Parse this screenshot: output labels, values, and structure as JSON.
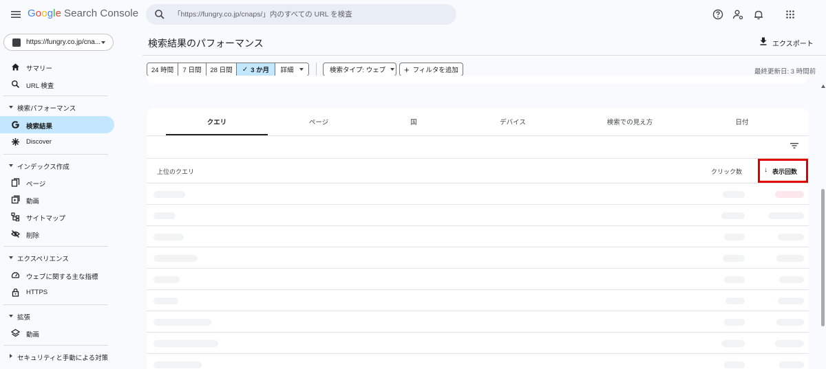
{
  "app": {
    "logo_letters": [
      "G",
      "o",
      "o",
      "g",
      "l",
      "e"
    ],
    "product": "Search Console"
  },
  "search": {
    "placeholder": "「https://fungry.co.jp/cnaps/」内のすべての URL を検査"
  },
  "property": {
    "label": "https://fungry.co.jp/cna..."
  },
  "sidebar": {
    "top_items": [
      {
        "label": "サマリー",
        "icon": "home-icon"
      },
      {
        "label": "URL 検査",
        "icon": "search-icon"
      }
    ],
    "sections": [
      {
        "title": "検索パフォーマンス",
        "items": [
          {
            "label": "検索結果",
            "icon": "google-g-icon",
            "active": true
          },
          {
            "label": "Discover",
            "icon": "asterisk-icon"
          }
        ]
      },
      {
        "title": "インデックス作成",
        "items": [
          {
            "label": "ページ",
            "icon": "pages-icon"
          },
          {
            "label": "動画",
            "icon": "video-page-icon"
          },
          {
            "label": "サイトマップ",
            "icon": "sitemap-icon"
          },
          {
            "label": "削除",
            "icon": "removal-icon"
          }
        ]
      },
      {
        "title": "エクスペリエンス",
        "items": [
          {
            "label": "ウェブに関する主な指標",
            "icon": "gauge-icon"
          },
          {
            "label": "HTTPS",
            "icon": "lock-icon"
          }
        ]
      },
      {
        "title": "拡張",
        "items": [
          {
            "label": "動画",
            "icon": "layers-icon"
          }
        ]
      },
      {
        "title": "セキュリティと手動による対策",
        "collapsed": true,
        "items": []
      }
    ]
  },
  "header": {
    "title": "検索結果のパフォーマンス",
    "export_label": "エクスポート"
  },
  "filters": {
    "date_ranges": [
      "24 時間",
      "7 日間",
      "28 日間",
      "3 か月"
    ],
    "selected_range": "3 か月",
    "details_label": "詳細",
    "search_type_label": "検索タイプ: ウェブ",
    "add_filter_label": "フィルタを追加",
    "last_updated": "最終更新日: 3 時間前"
  },
  "tabs": [
    "クエリ",
    "ページ",
    "国",
    "デバイス",
    "検索での見え方",
    "日付"
  ],
  "active_tab": "クエリ",
  "table": {
    "col_query": "上位のクエリ",
    "col_clicks": "クリック数",
    "col_impressions": "表示回数",
    "sort_arrow": "↓",
    "loading_rows": 9
  },
  "colors": {
    "accent_selected": "#c2e7ff",
    "highlight_box": "#e00000",
    "search_bg": "#e9eef6"
  }
}
